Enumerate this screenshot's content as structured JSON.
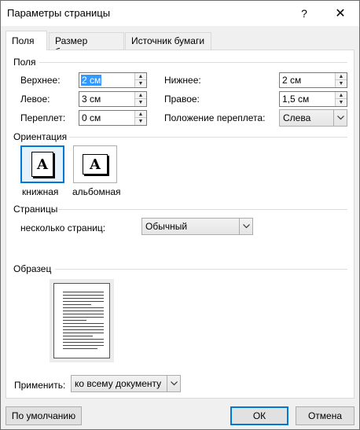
{
  "window": {
    "title": "Параметры страницы",
    "help_label": "?",
    "close_label": "✕"
  },
  "tabs": [
    {
      "label": "Поля",
      "active": true
    },
    {
      "label": "Размер бумаги",
      "active": false
    },
    {
      "label": "Источник бумаги",
      "active": false
    }
  ],
  "margins": {
    "section_title": "Поля",
    "top_label": "Верхнее:",
    "top_value": "2 см",
    "bottom_label": "Нижнее:",
    "bottom_value": "2 см",
    "left_label": "Левое:",
    "left_value": "3 см",
    "right_label": "Правое:",
    "right_value": "1,5 см",
    "gutter_label": "Переплет:",
    "gutter_value": "0 см",
    "gutter_pos_label": "Положение переплета:",
    "gutter_pos_value": "Слева"
  },
  "orientation": {
    "section_title": "Ориентация",
    "portrait_label": "книжная",
    "landscape_label": "альбомная",
    "icon_letter": "A",
    "selected": "portrait"
  },
  "pages": {
    "section_title": "Страницы",
    "multiple_label": "несколько страниц:",
    "multiple_value": "Обычный"
  },
  "preview": {
    "section_title": "Образец"
  },
  "apply": {
    "label": "Применить:",
    "value": "ко всему документу"
  },
  "buttons": {
    "default_label": "По умолчанию",
    "ok_label": "ОК",
    "cancel_label": "Отмена"
  },
  "colors": {
    "accent": "#0078d7",
    "selection": "#3399ff",
    "dialog_bg": "#f0f0f0"
  },
  "icons": {
    "spin_up": "up-arrow-icon",
    "spin_down": "down-arrow-icon",
    "dropdown": "chevron-down-icon"
  }
}
